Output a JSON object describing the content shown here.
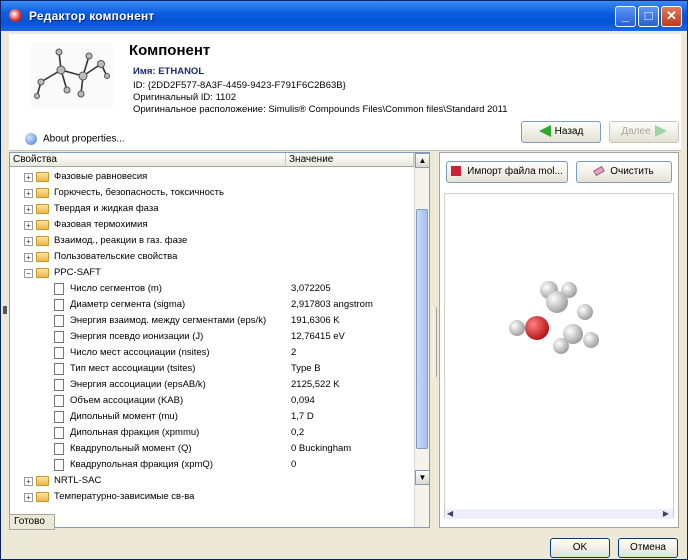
{
  "window": {
    "title": "Редактор компонент",
    "controls": [
      "_",
      "□",
      "✕"
    ]
  },
  "header": {
    "title": "Компонент",
    "name_line": "Имя: ETHANOL",
    "id_line": "ID: {2DD2F577-8A3F-4459-9423-F791F6C2B63B}",
    "orig_id_line": "Оригинальный ID: 1102",
    "orig_location_line": "Оригинальное расположение: Simulis® Compounds Files\\Common files\\Standard 2011",
    "about_label": "About properties...",
    "back_label": "Назад",
    "next_label": "Далее"
  },
  "tree": {
    "col_property": "Свойства",
    "col_value": "Значение",
    "groups_top": [
      {
        "label": "Фазовые равновесия"
      },
      {
        "label": "Горючесть, безопасность, токсичность"
      },
      {
        "label": "Твердая и жидкая фаза"
      },
      {
        "label": "Фазовая термохимия"
      },
      {
        "label": "Взаимод., реакции в газ. фазе"
      },
      {
        "label": "Пользовательские свойства"
      }
    ],
    "expanded_group": "PPC-SAFT",
    "properties": [
      {
        "label": "Число сегментов (m)",
        "value": "3,072205"
      },
      {
        "label": "Диаметр сегмента (sigma)",
        "value": "2,917803 angstrom"
      },
      {
        "label": "Энергия взаимод. между сегментами (eps/k)",
        "value": "191,6306 K"
      },
      {
        "label": "Энергия псевдо ионизации (J)",
        "value": "12,76415 eV"
      },
      {
        "label": "Число мест ассоциации (nsites)",
        "value": "2"
      },
      {
        "label": "Тип мест ассоциации (tsites)",
        "value": "Type B"
      },
      {
        "label": "Энергия ассоциации (epsAB/k)",
        "value": "2125,522 K"
      },
      {
        "label": "Объем ассоциации (KAB)",
        "value": "0,094"
      },
      {
        "label": "Дипольный момент (mu)",
        "value": "1,7 D"
      },
      {
        "label": "Дипольная фракция (xpmmu)",
        "value": "0,2"
      },
      {
        "label": "Квадрупольный момент (Q)",
        "value": "0 Buckingham"
      },
      {
        "label": "Квадрупольная фракция (xpmQ)",
        "value": "0"
      }
    ],
    "groups_bottom": [
      {
        "label": "NRTL-SAC"
      },
      {
        "label": "Температурно-зависимые св-ва"
      }
    ]
  },
  "status": "Готово",
  "right": {
    "import_label": "Импорт файла mol...",
    "clear_label": "Очистить"
  },
  "footer": {
    "ok_label": "OK",
    "cancel_label": "Отмена"
  },
  "colors": {
    "titlebar": "#0a5ee0",
    "oxygen": "#d42020",
    "carbon_hydrogen": "#e8e8e8",
    "arrow_green": "#2ea82e"
  }
}
